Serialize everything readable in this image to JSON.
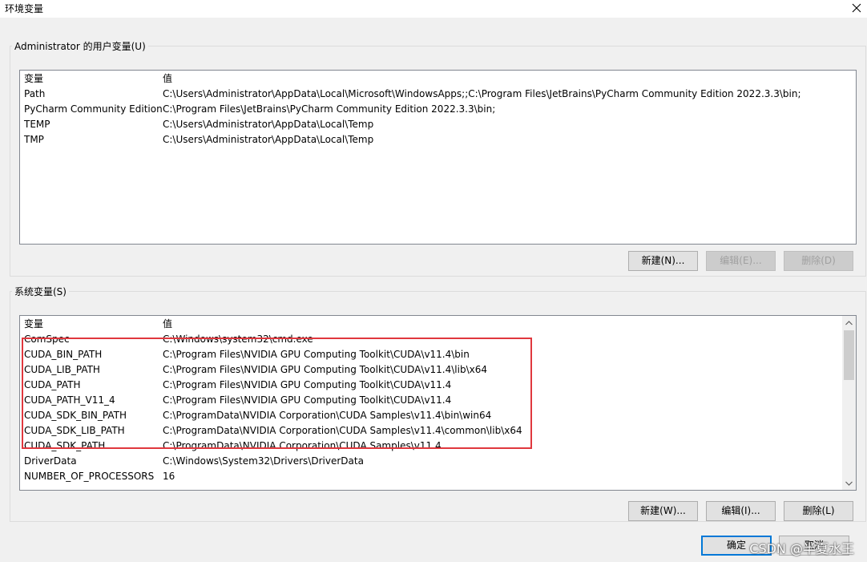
{
  "window": {
    "title": "环境变量"
  },
  "user_vars": {
    "title": "Administrator 的用户变量(U)",
    "headers": {
      "name": "变量",
      "value": "值"
    },
    "rows": [
      {
        "name": "Path",
        "value": "C:\\Users\\Administrator\\AppData\\Local\\Microsoft\\WindowsApps;;C:\\Program Files\\JetBrains\\PyCharm Community Edition 2022.3.3\\bin;"
      },
      {
        "name": "PyCharm Community Edition",
        "value": "C:\\Program Files\\JetBrains\\PyCharm Community Edition 2022.3.3\\bin;"
      },
      {
        "name": "TEMP",
        "value": "C:\\Users\\Administrator\\AppData\\Local\\Temp"
      },
      {
        "name": "TMP",
        "value": "C:\\Users\\Administrator\\AppData\\Local\\Temp"
      }
    ],
    "buttons": {
      "new": "新建(N)...",
      "edit": "编辑(E)...",
      "delete": "删除(D)"
    }
  },
  "sys_vars": {
    "title": "系统变量(S)",
    "headers": {
      "name": "变量",
      "value": "值"
    },
    "rows": [
      {
        "name": "ComSpec",
        "value": "C:\\Windows\\system32\\cmd.exe"
      },
      {
        "name": "CUDA_BIN_PATH",
        "value": "C:\\Program Files\\NVIDIA GPU Computing Toolkit\\CUDA\\v11.4\\bin"
      },
      {
        "name": "CUDA_LIB_PATH",
        "value": "C:\\Program Files\\NVIDIA GPU Computing Toolkit\\CUDA\\v11.4\\lib\\x64"
      },
      {
        "name": "CUDA_PATH",
        "value": "C:\\Program Files\\NVIDIA GPU Computing Toolkit\\CUDA\\v11.4"
      },
      {
        "name": "CUDA_PATH_V11_4",
        "value": "C:\\Program Files\\NVIDIA GPU Computing Toolkit\\CUDA\\v11.4"
      },
      {
        "name": "CUDA_SDK_BIN_PATH",
        "value": "C:\\ProgramData\\NVIDIA Corporation\\CUDA Samples\\v11.4\\bin\\win64"
      },
      {
        "name": "CUDA_SDK_LIB_PATH",
        "value": "C:\\ProgramData\\NVIDIA Corporation\\CUDA Samples\\v11.4\\common\\lib\\x64"
      },
      {
        "name": "CUDA_SDK_PATH",
        "value": "C:\\ProgramData\\NVIDIA Corporation\\CUDA Samples\\v11.4"
      },
      {
        "name": "DriverData",
        "value": "C:\\Windows\\System32\\Drivers\\DriverData"
      },
      {
        "name": "NUMBER_OF_PROCESSORS",
        "value": "16"
      }
    ],
    "buttons": {
      "new": "新建(W)...",
      "edit": "编辑(I)...",
      "delete": "删除(L)"
    }
  },
  "footer": {
    "ok": "确定",
    "cancel": "取消"
  },
  "watermark": "CSDN @半夏水王",
  "colors": {
    "highlight": "#e0383e",
    "accent": "#0078d7"
  }
}
